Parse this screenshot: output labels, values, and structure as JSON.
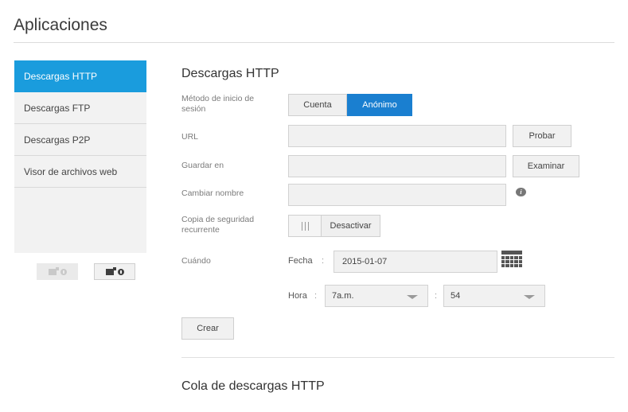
{
  "page": {
    "title": "Aplicaciones"
  },
  "sidebar": {
    "items": [
      {
        "label": "Descargas HTTP",
        "active": true
      },
      {
        "label": "Descargas FTP",
        "active": false
      },
      {
        "label": "Descargas P2P",
        "active": false
      },
      {
        "label": "Visor de archivos web",
        "active": false
      }
    ],
    "buttons": [
      {
        "name": "remove-app",
        "enabled": false
      },
      {
        "name": "add-app",
        "enabled": true
      }
    ]
  },
  "form": {
    "title": "Descargas HTTP",
    "login_method": {
      "label": "Método de inicio de sesión",
      "options": [
        "Cuenta",
        "Anónimo"
      ],
      "selected": "Anónimo"
    },
    "url": {
      "label": "URL",
      "value": "",
      "button": "Probar"
    },
    "save_to": {
      "label": "Guardar en",
      "value": "",
      "button": "Examinar"
    },
    "rename": {
      "label": "Cambiar nombre",
      "value": ""
    },
    "recurring_backup": {
      "label": "Copia de seguridad recurrente",
      "state": "Desactivar"
    },
    "when": {
      "label": "Cuándo",
      "date_label": "Fecha",
      "date_value": "2015-01-07",
      "time_label": "Hora",
      "hour_value": "7a.m.",
      "minute_value": "54",
      "separator": ":"
    },
    "create_button": "Crear"
  },
  "queue": {
    "title": "Cola de descargas HTTP"
  },
  "colors": {
    "accent": "#1a9cdd",
    "selected_segment": "#1a7fd0"
  }
}
